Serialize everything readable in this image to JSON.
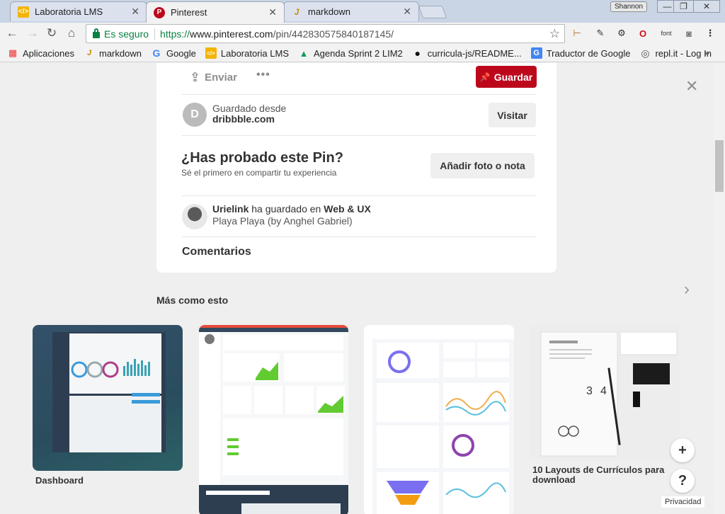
{
  "tabs": [
    {
      "label": "Laboratoria LMS",
      "icon": "laboratoria-icon"
    },
    {
      "label": "Pinterest",
      "icon": "pinterest-icon"
    },
    {
      "label": "markdown",
      "icon": "markdown-icon"
    }
  ],
  "window": {
    "profile": "Shannon"
  },
  "omnibox": {
    "secure_label": "Es seguro",
    "url_scheme": "https://",
    "url_host": "www.pinterest.com",
    "url_path": "/pin/442830575840187145/"
  },
  "bookmarks": [
    {
      "label": "Aplicaciones"
    },
    {
      "label": "markdown"
    },
    {
      "label": "Google"
    },
    {
      "label": "Laboratoria LMS"
    },
    {
      "label": "Agenda Sprint 2 LIM2"
    },
    {
      "label": "curricula-js/README..."
    },
    {
      "label": "Traductor de Google"
    },
    {
      "label": "repl.it - Log In"
    }
  ],
  "bookmarks_more": "»",
  "pin": {
    "share_label": "Enviar",
    "more_label": "•••",
    "save_label": "Guardar",
    "source_avatar_letter": "D",
    "source_prefix": "Guardado desde",
    "source_domain": "dribbble.com",
    "visit_label": "Visitar",
    "tried_title": "¿Has probado este Pin?",
    "tried_subtitle": "Sé el primero en compartir tu experiencia",
    "add_photo_label": "Añadir foto o nota",
    "saver_name": "Urielink",
    "saver_action": " ha guardado en ",
    "saver_board": "Web & UX",
    "saver_description": "Playa Playa (by Anghel Gabriel)",
    "comments_label": "Comentarios"
  },
  "more_like_this": {
    "title": "Más como esto",
    "items": [
      {
        "caption": "Dashboard"
      },
      {
        "caption": ""
      },
      {
        "caption": ""
      },
      {
        "caption": "10 Layouts de Currículos para download"
      }
    ]
  },
  "float": {
    "plus": "+",
    "help": "?",
    "privacy": "Privacidad"
  },
  "colors": {
    "pinterest_red": "#bd081c",
    "secure_green": "#0b8043"
  }
}
